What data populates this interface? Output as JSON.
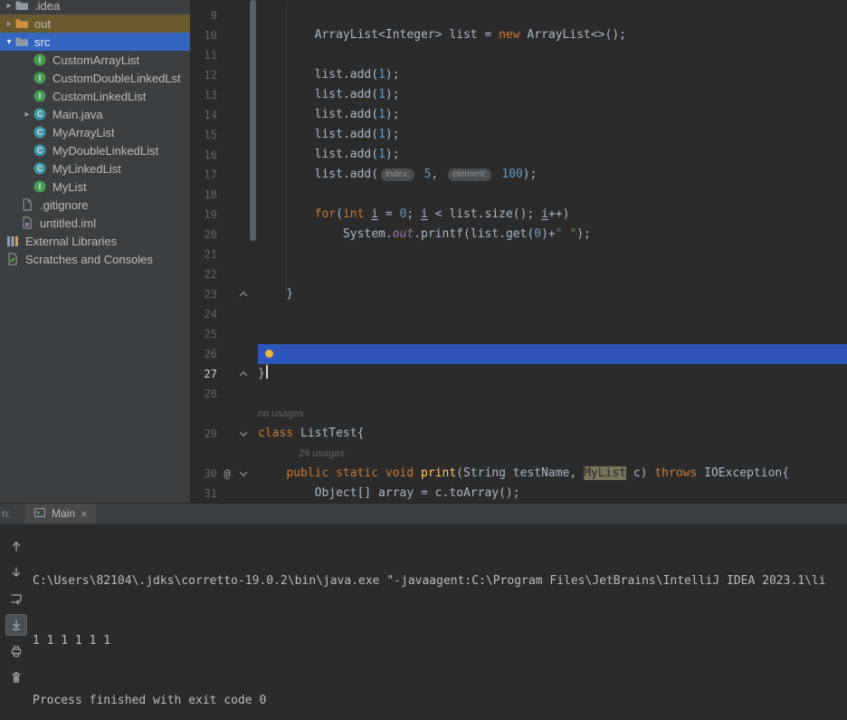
{
  "colors": {
    "editor_background": "#2b2b2b",
    "panel_background": "#3c3f41",
    "selection_blue": "#2d55bb",
    "keyword": "#cc7832",
    "string": "#6a8759",
    "number": "#6897bb",
    "method": "#ffc66b",
    "out_row_highlight": "#6a592c"
  },
  "project_panel": {
    "items": [
      {
        "label": ".idea",
        "icon": "folder",
        "level": "root-child",
        "expander": "collapsed"
      },
      {
        "label": "out",
        "icon": "folder-excluded",
        "level": "root-child",
        "expander": "collapsed",
        "state": "row-out"
      },
      {
        "label": "src",
        "icon": "folder",
        "level": "root-child",
        "expander": "expanded",
        "state": "row-selected"
      },
      {
        "label": "CustomArrayList",
        "icon": "interface",
        "level": "src-child"
      },
      {
        "label": "CustomDoubleLinkedLst",
        "icon": "interface",
        "level": "src-child"
      },
      {
        "label": "CustomLinkedList",
        "icon": "interface",
        "level": "src-child"
      },
      {
        "label": "Main.java",
        "icon": "class",
        "level": "src-child",
        "expander": "collapsed"
      },
      {
        "label": "MyArrayList",
        "icon": "class",
        "level": "src-child"
      },
      {
        "label": "MyDoubleLinkedList",
        "icon": "class",
        "level": "src-child"
      },
      {
        "label": "MyLinkedList",
        "icon": "class",
        "level": "src-child"
      },
      {
        "label": "MyList",
        "icon": "interface",
        "level": "src-child"
      },
      {
        "label": ".gitignore",
        "icon": "file-git",
        "level": "root-child-file"
      },
      {
        "label": "untitled.iml",
        "icon": "file-iml",
        "level": "root-child-file"
      },
      {
        "label": "External Libraries",
        "icon": "libraries",
        "level": "root"
      },
      {
        "label": "Scratches and Consoles",
        "icon": "scratches",
        "level": "root"
      }
    ]
  },
  "editor": {
    "rows": [
      {
        "num": "9",
        "tokens": []
      },
      {
        "num": "10",
        "tokens": [
          {
            "t": "        ArrayList<Integer> list = "
          },
          {
            "t": "new",
            "c": "kw"
          },
          {
            "t": " ArrayList<>();"
          }
        ]
      },
      {
        "num": "11",
        "tokens": []
      },
      {
        "num": "12",
        "tokens": [
          {
            "t": "        list.add("
          },
          {
            "t": "1",
            "c": "num"
          },
          {
            "t": ");"
          }
        ]
      },
      {
        "num": "13",
        "tokens": [
          {
            "t": "        list.add("
          },
          {
            "t": "1",
            "c": "num"
          },
          {
            "t": ");"
          }
        ]
      },
      {
        "num": "14",
        "tokens": [
          {
            "t": "        list.add("
          },
          {
            "t": "1",
            "c": "num"
          },
          {
            "t": ");"
          }
        ]
      },
      {
        "num": "15",
        "tokens": [
          {
            "t": "        list.add("
          },
          {
            "t": "1",
            "c": "num"
          },
          {
            "t": ");"
          }
        ]
      },
      {
        "num": "16",
        "tokens": [
          {
            "t": "        list.add("
          },
          {
            "t": "1",
            "c": "num"
          },
          {
            "t": ");"
          }
        ]
      },
      {
        "num": "17",
        "tokens": [
          {
            "t": "        list.add("
          },
          {
            "inlay": "index:"
          },
          {
            "t": " "
          },
          {
            "t": "5",
            "c": "num"
          },
          {
            "t": ", "
          },
          {
            "inlay": "element:"
          },
          {
            "t": " "
          },
          {
            "t": "100",
            "c": "num"
          },
          {
            "t": ");"
          }
        ]
      },
      {
        "num": "18",
        "tokens": []
      },
      {
        "num": "19",
        "tokens": [
          {
            "t": "        "
          },
          {
            "t": "for",
            "c": "kw"
          },
          {
            "t": "("
          },
          {
            "t": "int",
            "c": "kw"
          },
          {
            "t": " "
          },
          {
            "t": "i",
            "c": "var"
          },
          {
            "t": " = "
          },
          {
            "t": "0",
            "c": "num"
          },
          {
            "t": "; "
          },
          {
            "t": "i",
            "c": "var"
          },
          {
            "t": " < list.size(); "
          },
          {
            "t": "i",
            "c": "var"
          },
          {
            "t": "++)"
          }
        ]
      },
      {
        "num": "20",
        "tokens": [
          {
            "t": "            System."
          },
          {
            "t": "out",
            "c": "field"
          },
          {
            "t": ".printf(list.get("
          },
          {
            "t": "0",
            "c": "num"
          },
          {
            "t": ")+"
          },
          {
            "t": "\" \"",
            "c": "str"
          },
          {
            "t": ");"
          }
        ]
      },
      {
        "num": "21",
        "tokens": []
      },
      {
        "num": "22",
        "tokens": []
      },
      {
        "num": "23",
        "fold": "end",
        "tokens": [
          {
            "t": "    }"
          }
        ]
      },
      {
        "num": "24",
        "tokens": []
      },
      {
        "num": "25",
        "tokens": []
      },
      {
        "num": "26",
        "state": "sel",
        "tokens": [
          {
            "bulb": true
          }
        ]
      },
      {
        "num": "27",
        "state": "caret-line",
        "fold": "end",
        "tokens": [
          {
            "t": "}"
          },
          {
            "caret": true
          }
        ]
      },
      {
        "num": "28",
        "tokens": []
      },
      {
        "meta": "no usages",
        "indent": 0
      },
      {
        "num": "29",
        "fold": "start",
        "tokens": [
          {
            "t": "class ",
            "c": "kw"
          },
          {
            "t": "ListTest{"
          }
        ]
      },
      {
        "meta": "29 usages",
        "indent": 45
      },
      {
        "num": "30",
        "ann": "@",
        "fold": "start",
        "tokens": [
          {
            "t": "    "
          },
          {
            "t": "public static void ",
            "c": "kw"
          },
          {
            "t": "print",
            "c": "method"
          },
          {
            "t": "(String testName, "
          },
          {
            "t": "MyList",
            "c": "hl"
          },
          {
            "t": " c) "
          },
          {
            "t": "throws",
            "c": "kw"
          },
          {
            "t": " IOException{"
          }
        ]
      },
      {
        "num": "31",
        "tokens": [
          {
            "t": "        Object[] array = c.toArray();"
          }
        ]
      }
    ]
  },
  "console": {
    "run_label": "n:",
    "tab": {
      "label": "Main",
      "close": "×"
    },
    "toolbar": [
      "arrow-up",
      "arrow-down",
      "soft-wrap",
      "scroll-to-end",
      "print",
      "clear"
    ],
    "toolbar_active": "scroll-to-end",
    "output": [
      "C:\\Users\\82104\\.jdks\\corretto-19.0.2\\bin\\java.exe \"-javaagent:C:\\Program Files\\JetBrains\\IntelliJ IDEA 2023.1\\li",
      "1 1 1 1 1 1",
      "Process finished with exit code 0"
    ]
  }
}
